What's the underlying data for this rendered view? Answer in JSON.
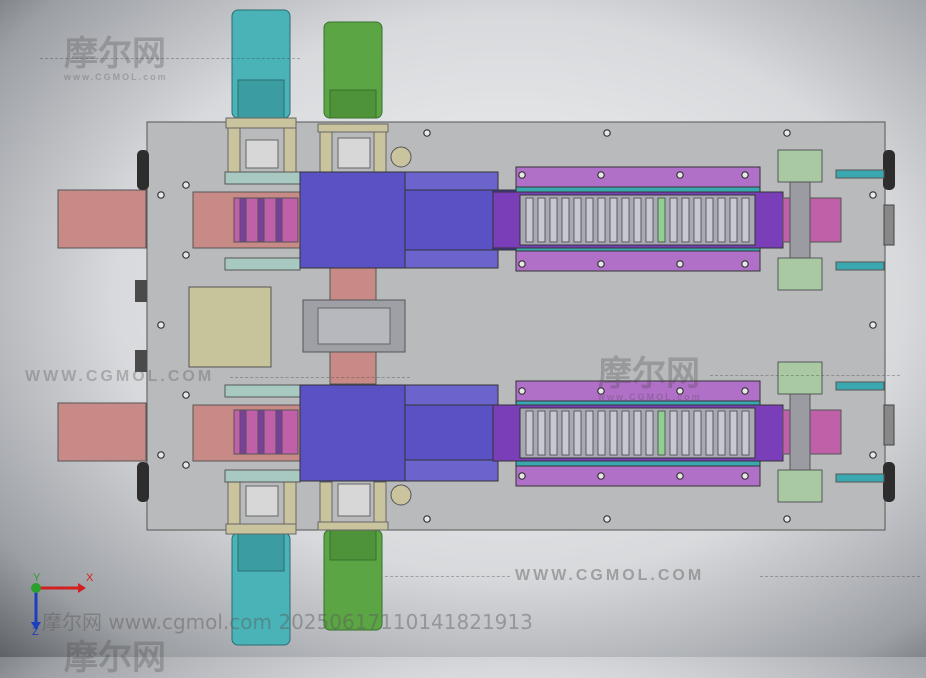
{
  "watermark": {
    "logo_text": "摩尔网",
    "logo_url": "www.CGMOL.com",
    "url_caption_upper": "WWW.CGMOL.COM",
    "url_caption_left": "WWW.CGMOL.COM",
    "stamp_text": "摩尔网 www.cgmol.com 20250617110141821913"
  },
  "view_triad": {
    "x_label": "X",
    "y_label": "Y",
    "z_label": "Z"
  },
  "colors": {
    "base_plate": "#b8b9bb",
    "motor_cyan": "#49b3b7",
    "motor_green": "#5ca545",
    "carriage_blue": "#5a52c4",
    "rail_purple": "#7a3fb8",
    "rail_magenta": "#b070c8",
    "teal": "#3aa8b0",
    "salmon": "#c78a86",
    "tan": "#c9c39e"
  }
}
